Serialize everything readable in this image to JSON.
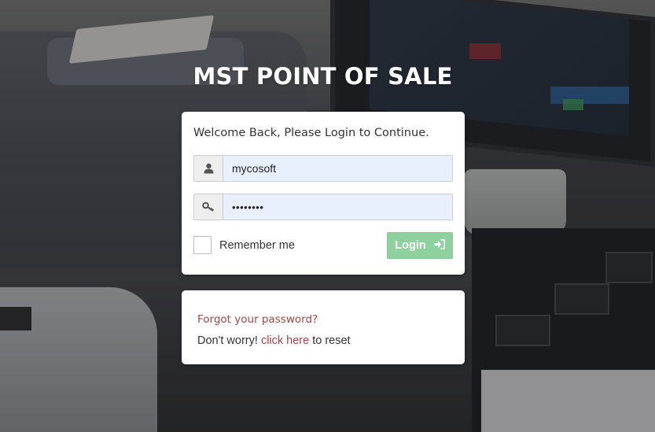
{
  "app": {
    "title": "MST POINT OF SALE"
  },
  "login": {
    "welcome": "Welcome Back, Please Login to Continue.",
    "username_value": "mycosoft",
    "password_value": "mycosoft",
    "remember_label": "Remember me",
    "login_label": "Login"
  },
  "forgot": {
    "title": "Forgot your password?",
    "prefix": "Don't worry!",
    "link": "click here",
    "suffix": "to reset"
  },
  "colors": {
    "accent_link": "#a94442",
    "login_button": "#8fd19e",
    "input_autofill": "#e8f0fe"
  },
  "icons": {
    "username": "user-icon",
    "password": "key-icon",
    "login": "sign-in-icon"
  }
}
